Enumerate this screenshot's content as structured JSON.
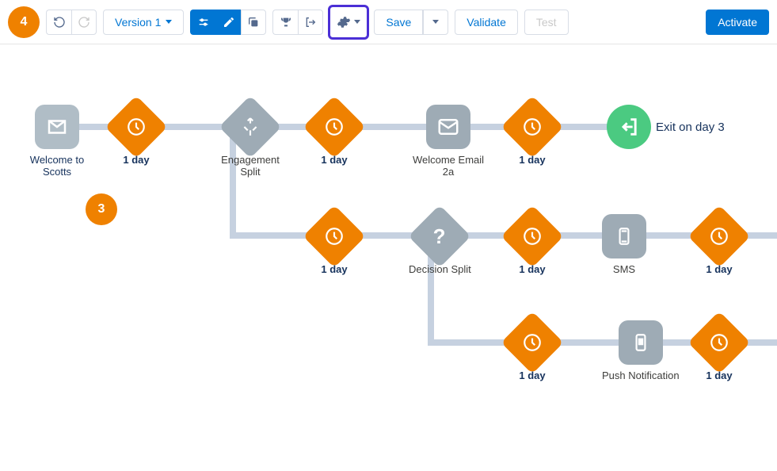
{
  "toolbar": {
    "annotation_badge": "4",
    "version_label": "Version 1",
    "save_label": "Save",
    "validate_label": "Validate",
    "test_label": "Test",
    "activate_label": "Activate"
  },
  "canvas": {
    "float_badge": "3",
    "exit_label": "Exit on day 3",
    "nodes": {
      "welcome_scotts": "Welcome to Scotts",
      "wait1": "1 day",
      "engagement_split": "Engagement Split",
      "wait2": "1 day",
      "welcome_2a": "Welcome Email 2a",
      "wait3": "1 day",
      "wait4": "1 day",
      "decision_split": "Decision Split",
      "wait5": "1 day",
      "sms": "SMS",
      "wait6": "1 day",
      "wait7": "1 day",
      "push": "Push Notification",
      "wait8": "1 day"
    }
  }
}
